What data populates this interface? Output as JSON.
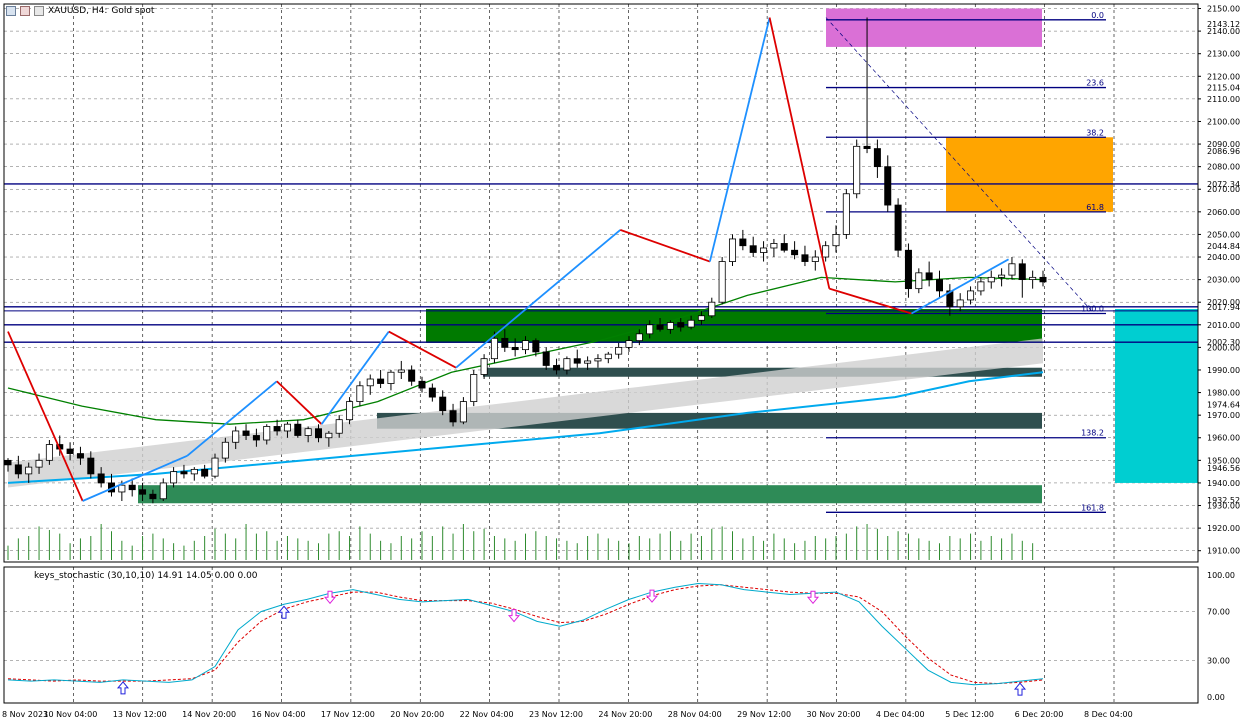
{
  "header": {
    "symbol_label": "XAUUSD, H4:",
    "description": "Gold spot"
  },
  "indicator": {
    "label": "keys_stochastic (30,10,10) 14.91 14.05 0.00 0.00"
  },
  "colors": {
    "bull_candle": "#000000",
    "bear_candle": "#000000",
    "zigzag_up": "#1e90ff",
    "zigzag_down": "#dd0000",
    "fib": "#000080",
    "ma_green": "#008000",
    "ma_cyan": "#00aaee",
    "volume": "#2e8b2e",
    "zone_green": "#007a00",
    "zone_teal": "#2f4f4f",
    "zone_magenta": "#da70d6",
    "zone_orange": "#ffa500",
    "zone_cyan": "#00ced1",
    "stoch_main": "#00aacc",
    "stoch_signal": "#dd0000",
    "arrow_up": "#2222dd",
    "arrow_down": "#dd22dd",
    "hline": "#000080"
  },
  "chart_data": {
    "type": "candlestick",
    "symbol": "XAUUSD",
    "timeframe": "H4",
    "ylim": [
      1905,
      2152
    ],
    "y_ticks": [
      2150,
      2140,
      2130,
      2120,
      2110,
      2100,
      2090,
      2080,
      2070,
      2060,
      2050,
      2040,
      2030,
      2020,
      2010,
      2000,
      1990,
      1980,
      1970,
      1960,
      1950,
      1940,
      1930,
      1920,
      1910
    ],
    "y_tick_labels": [
      "2150.00",
      "2140.00",
      "2130.00",
      "2120.00",
      "2110.00",
      "2100.00",
      "2090.00",
      "2080.00",
      "2070.00",
      "2060.00",
      "2050.00",
      "2040.00",
      "2030.00",
      "2020.00",
      "2010.00",
      "2000.00",
      "1990.00",
      "1980.00",
      "1970.00",
      "1960.00",
      "1950.00",
      "1940.00",
      "1930.00",
      "1920.00",
      "1910.00"
    ],
    "price_labels": [
      {
        "value": 2143.12,
        "text": "2143.12"
      },
      {
        "value": 2115.04,
        "text": "2115.04"
      },
      {
        "value": 2086.96,
        "text": "2086.96"
      },
      {
        "value": 2072.34,
        "text": "2072.34"
      },
      {
        "value": 2044.84,
        "text": "2044.84"
      },
      {
        "value": 2017.94,
        "text": "2017.94"
      },
      {
        "value": 2002.3,
        "text": "2002.30"
      },
      {
        "value": 1974.64,
        "text": "1974.64"
      },
      {
        "value": 1946.56,
        "text": "1946.56"
      },
      {
        "value": 1932.52,
        "text": "1932.52"
      }
    ],
    "x_labels": [
      "8 Nov 2023",
      "10 Nov 04:00",
      "13 Nov 12:00",
      "14 Nov 20:00",
      "16 Nov 04:00",
      "17 Nov 12:00",
      "20 Nov 20:00",
      "22 Nov 04:00",
      "23 Nov 12:00",
      "24 Nov 20:00",
      "28 Nov 04:00",
      "29 Nov 12:00",
      "30 Nov 20:00",
      "4 Dec 04:00",
      "5 Dec 12:00",
      "6 Dec 20:00",
      "8 Dec 04:00"
    ],
    "x_label_positions": [
      0,
      15.5,
      31,
      46.5,
      62,
      77.5,
      93,
      108.5,
      124,
      139.5,
      155,
      170.5,
      186,
      201.5,
      217,
      232.5,
      248
    ],
    "candles": [
      [
        1950,
        1951,
        1945,
        1948
      ],
      [
        1948,
        1952,
        1942,
        1944
      ],
      [
        1944,
        1949,
        1940,
        1947
      ],
      [
        1947,
        1953,
        1944,
        1950
      ],
      [
        1950,
        1959,
        1948,
        1957
      ],
      [
        1957,
        1961,
        1952,
        1955
      ],
      [
        1955,
        1958,
        1950,
        1953
      ],
      [
        1953,
        1956,
        1948,
        1951
      ],
      [
        1951,
        1954,
        1942,
        1944
      ],
      [
        1944,
        1947,
        1938,
        1940
      ],
      [
        1940,
        1944,
        1934,
        1936
      ],
      [
        1936,
        1941,
        1932,
        1939
      ],
      [
        1939,
        1942,
        1934,
        1937
      ],
      [
        1937,
        1940,
        1932,
        1935
      ],
      [
        1935,
        1937,
        1931,
        1933
      ],
      [
        1933,
        1942,
        1932,
        1940
      ],
      [
        1940,
        1947,
        1938,
        1945
      ],
      [
        1945,
        1948,
        1942,
        1944
      ],
      [
        1944,
        1947,
        1941,
        1946
      ],
      [
        1946,
        1948,
        1942,
        1943
      ],
      [
        1943,
        1953,
        1942,
        1951
      ],
      [
        1951,
        1960,
        1949,
        1958
      ],
      [
        1958,
        1965,
        1955,
        1963
      ],
      [
        1963,
        1966,
        1959,
        1961
      ],
      [
        1961,
        1964,
        1956,
        1959
      ],
      [
        1959,
        1966,
        1957,
        1965
      ],
      [
        1965,
        1968,
        1961,
        1963
      ],
      [
        1963,
        1967,
        1960,
        1966
      ],
      [
        1966,
        1968,
        1960,
        1961
      ],
      [
        1961,
        1965,
        1958,
        1964
      ],
      [
        1964,
        1966,
        1958,
        1960
      ],
      [
        1960,
        1963,
        1956,
        1962
      ],
      [
        1962,
        1970,
        1960,
        1968
      ],
      [
        1968,
        1978,
        1966,
        1976
      ],
      [
        1976,
        1985,
        1974,
        1983
      ],
      [
        1983,
        1988,
        1979,
        1986
      ],
      [
        1986,
        1990,
        1982,
        1984
      ],
      [
        1984,
        1990,
        1981,
        1989
      ],
      [
        1989,
        1994,
        1986,
        1990
      ],
      [
        1990,
        1992,
        1983,
        1985
      ],
      [
        1985,
        1987,
        1980,
        1982
      ],
      [
        1982,
        1984,
        1976,
        1978
      ],
      [
        1978,
        1981,
        1970,
        1972
      ],
      [
        1972,
        1975,
        1965,
        1967
      ],
      [
        1967,
        1978,
        1966,
        1976
      ],
      [
        1976,
        1990,
        1974,
        1988
      ],
      [
        1988,
        1997,
        1986,
        1995
      ],
      [
        1995,
        2007,
        1993,
        2004
      ],
      [
        2004,
        2008,
        1998,
        2000
      ],
      [
        2000,
        2004,
        1996,
        1999
      ],
      [
        1999,
        2005,
        1997,
        2003
      ],
      [
        2003,
        2004,
        1996,
        1998
      ],
      [
        1998,
        2000,
        1990,
        1992
      ],
      [
        1992,
        1995,
        1988,
        1990
      ],
      [
        1990,
        1996,
        1988,
        1995
      ],
      [
        1995,
        1999,
        1991,
        1993
      ],
      [
        1993,
        1996,
        1990,
        1994
      ],
      [
        1994,
        1997,
        1991,
        1995
      ],
      [
        1995,
        1998,
        1993,
        1997
      ],
      [
        1997,
        2002,
        1995,
        2000
      ],
      [
        2000,
        2005,
        1998,
        2003
      ],
      [
        2003,
        2008,
        2001,
        2006
      ],
      [
        2006,
        2012,
        2004,
        2010
      ],
      [
        2010,
        2013,
        2007,
        2008
      ],
      [
        2008,
        2012,
        2006,
        2011
      ],
      [
        2011,
        2013,
        2007,
        2009
      ],
      [
        2009,
        2014,
        2008,
        2012
      ],
      [
        2012,
        2016,
        2010,
        2014
      ],
      [
        2014,
        2022,
        2013,
        2020
      ],
      [
        2020,
        2040,
        2019,
        2038
      ],
      [
        2038,
        2050,
        2036,
        2048
      ],
      [
        2048,
        2052,
        2043,
        2045
      ],
      [
        2045,
        2049,
        2040,
        2042
      ],
      [
        2042,
        2047,
        2038,
        2044
      ],
      [
        2044,
        2048,
        2040,
        2046
      ],
      [
        2046,
        2050,
        2042,
        2043
      ],
      [
        2043,
        2047,
        2039,
        2041
      ],
      [
        2041,
        2045,
        2036,
        2038
      ],
      [
        2038,
        2043,
        2034,
        2040
      ],
      [
        2040,
        2047,
        2038,
        2045
      ],
      [
        2045,
        2054,
        2042,
        2050
      ],
      [
        2050,
        2070,
        2048,
        2068
      ],
      [
        2068,
        2092,
        2066,
        2089
      ],
      [
        2089,
        2146,
        2086,
        2088
      ],
      [
        2088,
        2092,
        2075,
        2080
      ],
      [
        2080,
        2085,
        2060,
        2063
      ],
      [
        2063,
        2066,
        2040,
        2043
      ],
      [
        2043,
        2046,
        2022,
        2026
      ],
      [
        2026,
        2035,
        2024,
        2033
      ],
      [
        2033,
        2038,
        2027,
        2030
      ],
      [
        2030,
        2034,
        2022,
        2025
      ],
      [
        2025,
        2028,
        2014,
        2018
      ],
      [
        2018,
        2024,
        2016,
        2021
      ],
      [
        2021,
        2027,
        2019,
        2025
      ],
      [
        2025,
        2031,
        2023,
        2029
      ],
      [
        2029,
        2034,
        2026,
        2031
      ],
      [
        2031,
        2035,
        2027,
        2032
      ],
      [
        2032,
        2040,
        2030,
        2037
      ],
      [
        2037,
        2039,
        2022,
        2030
      ],
      [
        2030,
        2034,
        2026,
        2031
      ],
      [
        2031,
        2034,
        2027,
        2029
      ]
    ],
    "volume": [
      12,
      18,
      20,
      28,
      25,
      22,
      14,
      18,
      20,
      30,
      24,
      16,
      12,
      20,
      22,
      18,
      14,
      12,
      16,
      20,
      26,
      22,
      18,
      30,
      22,
      24,
      16,
      20,
      18,
      16,
      14,
      22,
      24,
      20,
      28,
      22,
      16,
      14,
      20,
      18,
      24,
      20,
      28,
      22,
      30,
      24,
      26,
      20,
      18,
      16,
      22,
      24,
      20,
      18,
      16,
      14,
      20,
      22,
      18,
      16,
      14,
      20,
      18,
      22,
      24,
      16,
      22,
      20,
      26,
      28,
      24,
      18,
      20,
      16,
      22,
      18,
      14,
      16,
      20,
      18,
      20,
      22,
      28,
      30,
      26,
      20,
      24,
      22,
      18,
      16,
      14,
      20,
      18,
      22,
      16,
      20,
      18,
      22,
      16,
      14
    ],
    "zigzag": [
      [
        0,
        2007
      ],
      [
        10,
        1932
      ],
      [
        24,
        1952
      ],
      [
        36,
        1985
      ],
      [
        42,
        1966
      ],
      [
        51,
        2007
      ],
      [
        60,
        1991
      ],
      [
        82,
        2052
      ],
      [
        94,
        2038
      ],
      [
        102,
        2146
      ],
      [
        110,
        2026
      ],
      [
        121,
        2015
      ],
      [
        134,
        2039
      ]
    ],
    "ma_green": [
      [
        0,
        1982
      ],
      [
        10,
        1974
      ],
      [
        20,
        1968
      ],
      [
        30,
        1966
      ],
      [
        40,
        1968
      ],
      [
        50,
        1976
      ],
      [
        60,
        1989
      ],
      [
        70,
        1996
      ],
      [
        80,
        2003
      ],
      [
        90,
        2012
      ],
      [
        100,
        2023
      ],
      [
        110,
        2031
      ],
      [
        120,
        2029
      ],
      [
        130,
        2031
      ],
      [
        140,
        2030
      ]
    ],
    "ma_cyan": [
      [
        0,
        1940
      ],
      [
        20,
        1944
      ],
      [
        40,
        1950
      ],
      [
        60,
        1956
      ],
      [
        80,
        1962
      ],
      [
        100,
        1971
      ],
      [
        120,
        1978
      ],
      [
        130,
        1985
      ],
      [
        140,
        1989
      ]
    ],
    "fib_levels": [
      {
        "label": "0.0",
        "value": 2145
      },
      {
        "label": "23.6",
        "value": 2115
      },
      {
        "label": "38.2",
        "value": 2093
      },
      {
        "label": "61.8",
        "value": 2060
      },
      {
        "label": "100.0",
        "value": 2015
      },
      {
        "label": "138.2",
        "value": 1960
      },
      {
        "label": "161.8",
        "value": 1927
      }
    ],
    "hlines": [
      2072.34,
      2017.94,
      2010,
      2002.3
    ],
    "zones": [
      {
        "name": "zone-magenta",
        "y0": 2133,
        "y1": 2150,
        "c0": 102,
        "c1": 140,
        "color": "#da70d6"
      },
      {
        "name": "zone-orange",
        "y0": 2060,
        "y1": 2093,
        "c0": 120,
        "c1": 149,
        "color": "#ffa500"
      },
      {
        "name": "zone-green-main",
        "y0": 2002,
        "y1": 2017,
        "c0": 55,
        "c1": 140,
        "color": "#007a00"
      },
      {
        "name": "zone-teal-1",
        "y0": 1987,
        "y1": 1991,
        "c0": 60,
        "c1": 140,
        "color": "#2f4f4f"
      },
      {
        "name": "zone-teal-2",
        "y0": 1964,
        "y1": 1971,
        "c0": 42,
        "c1": 140,
        "color": "#2f4f4f"
      },
      {
        "name": "zone-green-low",
        "y0": 1931,
        "y1": 1939,
        "c0": 10,
        "c1": 140,
        "color": "#2e8b57"
      },
      {
        "name": "zone-cyan",
        "y0": 1940,
        "y1": 2017,
        "c0": 151,
        "c1": 158,
        "color": "#00ced1"
      }
    ],
    "stochastic": {
      "ylim": [
        0,
        100
      ],
      "y_ticks": [
        100,
        70,
        30,
        0
      ],
      "y_tick_labels": [
        "100.00",
        "70.00",
        "30.00",
        "0.00"
      ],
      "main": [
        14,
        13,
        14,
        13,
        12,
        14,
        13,
        12,
        14,
        25,
        55,
        70,
        76,
        80,
        85,
        88,
        84,
        80,
        78,
        79,
        80,
        75,
        70,
        62,
        58,
        63,
        72,
        80,
        86,
        90,
        93,
        92,
        88,
        86,
        84,
        85,
        86,
        78,
        58,
        40,
        22,
        12,
        10,
        11,
        13,
        15
      ],
      "signal": [
        15,
        14,
        13,
        14,
        13,
        13,
        13,
        14,
        15,
        22,
        45,
        62,
        72,
        78,
        82,
        86,
        86,
        82,
        79,
        79,
        79,
        77,
        72,
        66,
        61,
        62,
        68,
        76,
        83,
        88,
        91,
        92,
        90,
        88,
        86,
        85,
        85,
        82,
        70,
        50,
        32,
        18,
        12,
        11,
        12,
        14
      ],
      "arrows_up": [
        5,
        12,
        44
      ],
      "arrows_down": [
        14,
        22,
        28,
        35
      ]
    }
  }
}
